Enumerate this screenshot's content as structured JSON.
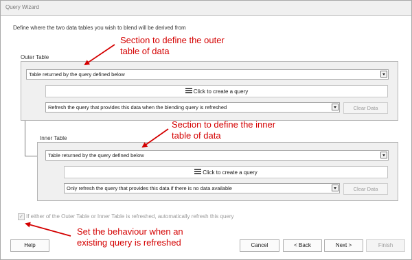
{
  "window": {
    "title": "Query Wizard"
  },
  "intro_text": "Define where the two data tables you wish to blend will be derived from",
  "outer": {
    "legend": "Outer Table",
    "source_select": "Table returned by the query defined below",
    "create_query_label": "Click to create a query",
    "refresh_select": "Refresh the query that provides this data when the blending query is refreshed",
    "clear_data_label": "Clear Data"
  },
  "inner": {
    "legend": "Inner Table",
    "source_select": "Table returned by the query defined below",
    "create_query_label": "Click to create a query",
    "refresh_select": "Only refresh the query that provides this data if there is no data available",
    "clear_data_label": "Clear Data"
  },
  "auto_refresh": {
    "checked": true,
    "mark": "✓",
    "label": "If either of the Outer Table or Inner Table is refreshed, automatically refresh this query"
  },
  "buttons": {
    "help": "Help",
    "cancel": "Cancel",
    "back": "< Back",
    "next": "Next >",
    "finish": "Finish"
  },
  "annotations": {
    "outer_line1": "Section to define the outer",
    "outer_line2": "table of data",
    "inner_line1": "Section to define the inner",
    "inner_line2": "table of data",
    "behaviour_line1": "Set the behaviour when an",
    "behaviour_line2": "existing query is refreshed"
  },
  "colors": {
    "annotation": "#d40000",
    "group_bg": "#f0f0f0",
    "border": "#b4b4b4"
  },
  "icons": {
    "create_query": "database-icon",
    "dropdown": "chevron-down-icon"
  }
}
